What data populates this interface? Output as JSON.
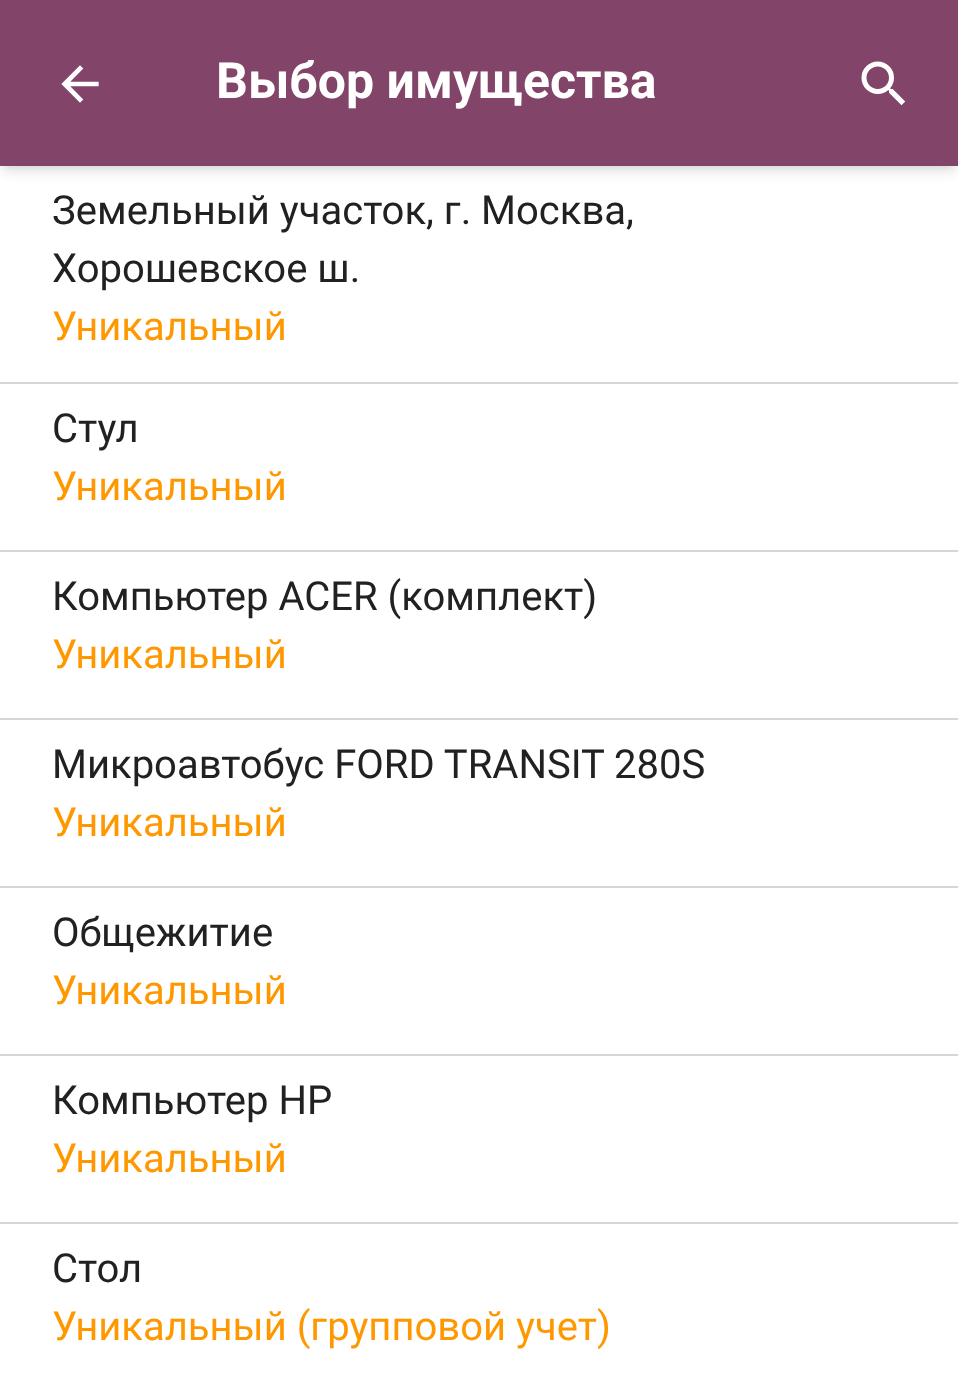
{
  "app_bar": {
    "title": "Выбор имущества"
  },
  "items": [
    {
      "name": "Земельный участок, г. Москва, Хорошевское ш.",
      "type": "Уникальный"
    },
    {
      "name": "Стул",
      "type": "Уникальный"
    },
    {
      "name": "Компьютер ACER (комплект)",
      "type": "Уникальный"
    },
    {
      "name": "Микроавтобус FORD TRANSIT 280S",
      "type": "Уникальный"
    },
    {
      "name": "Общежитие",
      "type": "Уникальный"
    },
    {
      "name": "Компьютер HP",
      "type": "Уникальный"
    },
    {
      "name": "Стол",
      "type": "Уникальный (групповой учет)"
    }
  ]
}
